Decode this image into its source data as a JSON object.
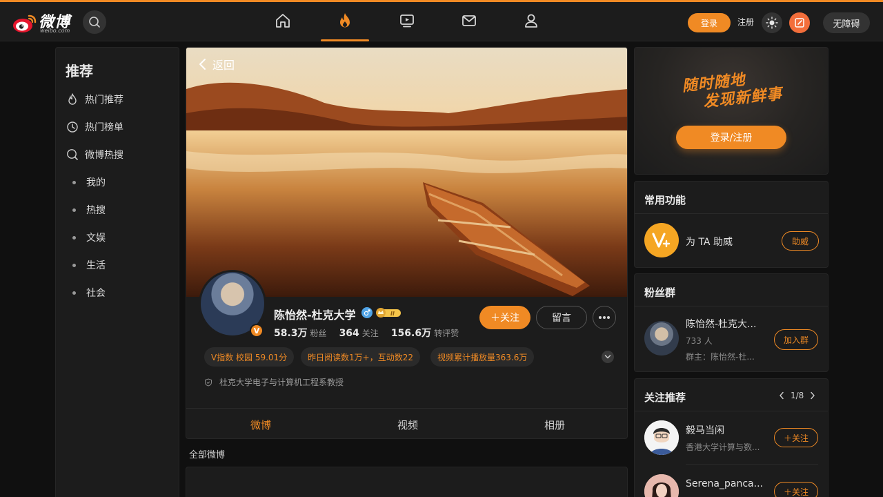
{
  "brand": {
    "logo_text": "微博",
    "logo_sub": "weibo.com"
  },
  "header": {
    "nav": [
      "home-icon",
      "hot-icon",
      "video-icon",
      "mail-icon",
      "profile-icon"
    ],
    "login_label": "登录",
    "register_label": "注册",
    "a11y_label": "无障碍",
    "accent": "#f08a24"
  },
  "sidebar": {
    "title": "推荐",
    "items": [
      {
        "label": "热门推荐",
        "icon": "fire-icon"
      },
      {
        "label": "热门榜单",
        "icon": "clock-icon"
      },
      {
        "label": "微博热搜",
        "icon": "search-icon"
      },
      {
        "label": "我的"
      },
      {
        "label": "热搜"
      },
      {
        "label": "文娱"
      },
      {
        "label": "生活"
      },
      {
        "label": "社会"
      }
    ]
  },
  "profile": {
    "back_label": "返回",
    "name": "陈怡然-杜克大学",
    "badge": "V",
    "stats": [
      {
        "num": "58.3万",
        "label": "粉丝"
      },
      {
        "num": "364",
        "label": "关注"
      },
      {
        "num": "156.6万",
        "label": "转评赞"
      }
    ],
    "follow_label": "＋关注",
    "message_label": "留言",
    "tags": [
      "V指数 校园 59.01分",
      "昨日阅读数1万+，互动数22",
      "视频累计播放量363.6万"
    ],
    "description": "杜克大学电子与计算机工程系教授",
    "tabs": [
      "微博",
      "视频",
      "相册"
    ],
    "section_label": "全部微博"
  },
  "right": {
    "promo_line1": "随时随地",
    "promo_line2": "发现新鲜事",
    "promo_button": "登录/注册",
    "functions_title": "常用功能",
    "function_label": "为 TA 助威",
    "function_button": "助威",
    "fan_title": "粉丝群",
    "fan_group_name": "陈怡然-杜克大...",
    "fan_count": "733 人",
    "fan_owner": "群主：陈怡然-杜...",
    "fan_button": "加入群",
    "rec_title": "关注推荐",
    "rec_page": "1/8",
    "recommendations": [
      {
        "name": "毅马当闲",
        "desc": "香港大学计算与数...",
        "button": "＋关注"
      },
      {
        "name": "Serena_panca...",
        "desc": "",
        "button": "＋关注"
      }
    ]
  }
}
